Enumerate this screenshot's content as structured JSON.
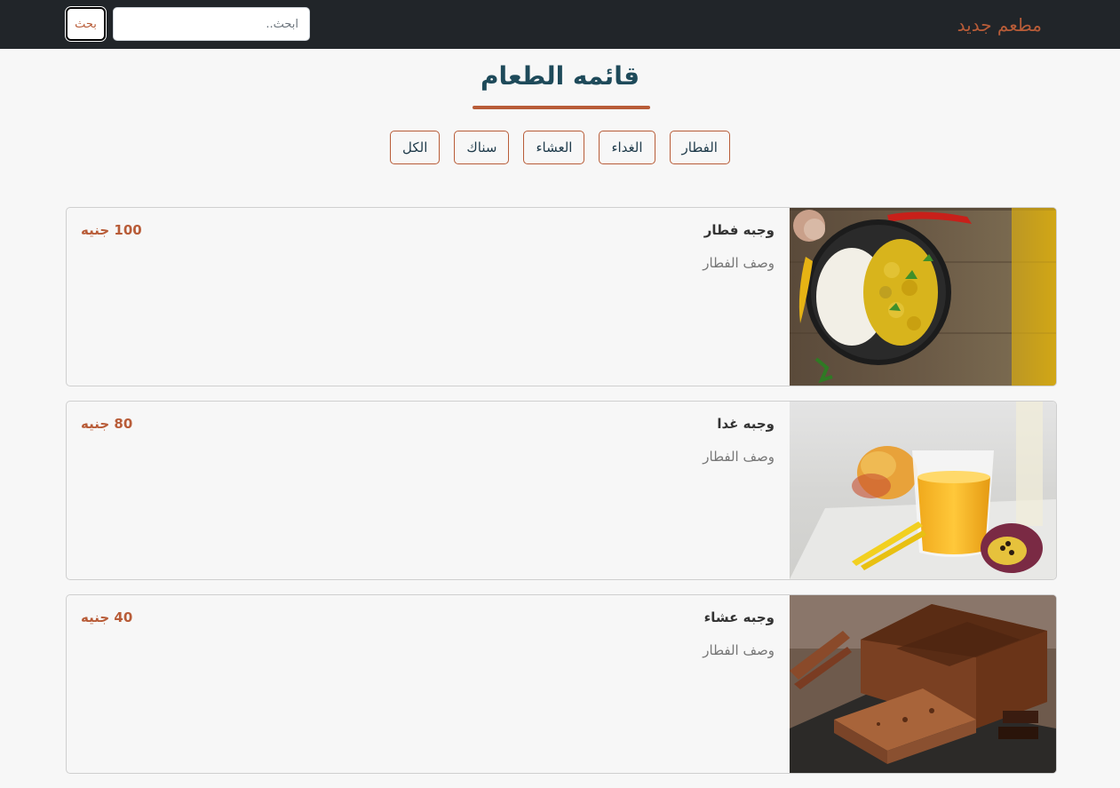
{
  "navbar": {
    "brand": "مطعم جديد",
    "search": {
      "placeholder": "ابحث..",
      "value": "",
      "button_label": "بحث"
    }
  },
  "page": {
    "title": "قائمه الطعام"
  },
  "filters": [
    {
      "label": "الفطار"
    },
    {
      "label": "الغداء"
    },
    {
      "label": "العشاء"
    },
    {
      "label": "سناك"
    },
    {
      "label": "الكل"
    }
  ],
  "menu": {
    "items": [
      {
        "name": "وجبه فطار",
        "description": "وصف الفطار",
        "price": "100 جنيه"
      },
      {
        "name": "وجبه غدا",
        "description": "وصف الفطار",
        "price": "80 جنيه"
      },
      {
        "name": "وجبه عشاء",
        "description": "وصف الفطار",
        "price": "40 جنيه"
      }
    ]
  },
  "colors": {
    "accent": "#b85c38",
    "navbar": "#212529",
    "title": "#1e4a5a",
    "background": "#f7f7f7"
  }
}
